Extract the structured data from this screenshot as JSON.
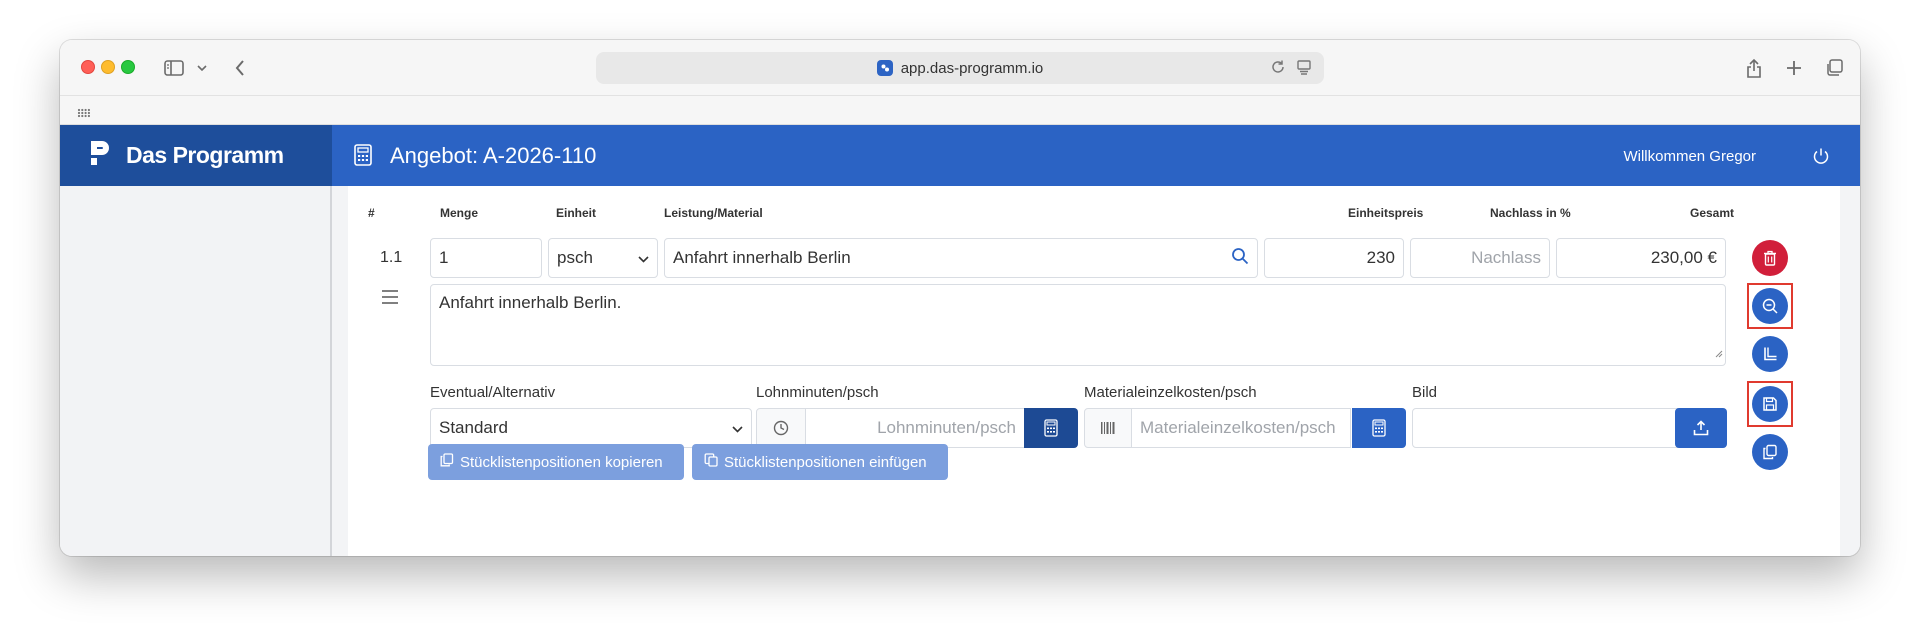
{
  "browser": {
    "url": "app.das-programm.io"
  },
  "app": {
    "brand": "Das Programm",
    "page_title": "Angebot: A-2026-110",
    "welcome": "Willkommen Gregor"
  },
  "table": {
    "headers": {
      "number": "#",
      "quantity": "Menge",
      "unit": "Einheit",
      "service": "Leistung/Material",
      "unit_price": "Einheitspreis",
      "discount": "Nachlass in %",
      "total": "Gesamt"
    }
  },
  "row": {
    "position": "1.1",
    "quantity": "1",
    "unit": "psch",
    "service": "Anfahrt innerhalb Berlin",
    "unit_price": "230",
    "discount_placeholder": "Nachlass",
    "total": "230,00 €",
    "description": "Anfahrt innerhalb Berlin.",
    "eventual_label": "Eventual/Alternativ",
    "eventual_value": "Standard",
    "labor_label": "Lohnminuten/psch",
    "labor_placeholder": "Lohnminuten/psch",
    "material_label": "Materialeinzelkosten/psch",
    "material_placeholder": "Materialeinzelkosten/psch",
    "image_label": "Bild"
  },
  "actions": {
    "copy_bom": "Stücklistenpositionen kopieren",
    "paste_bom": "Stücklistenpositionen einfügen"
  },
  "side_buttons": [
    "trash-icon",
    "zoom-out-icon",
    "corner-icon",
    "save-icon",
    "copy-icon"
  ],
  "colors": {
    "primary": "#2b63c4",
    "brand_dark": "#1e4e9b",
    "danger": "#d11f3a",
    "highlight": "#e03a2f",
    "action_button": "#7c9fde"
  }
}
